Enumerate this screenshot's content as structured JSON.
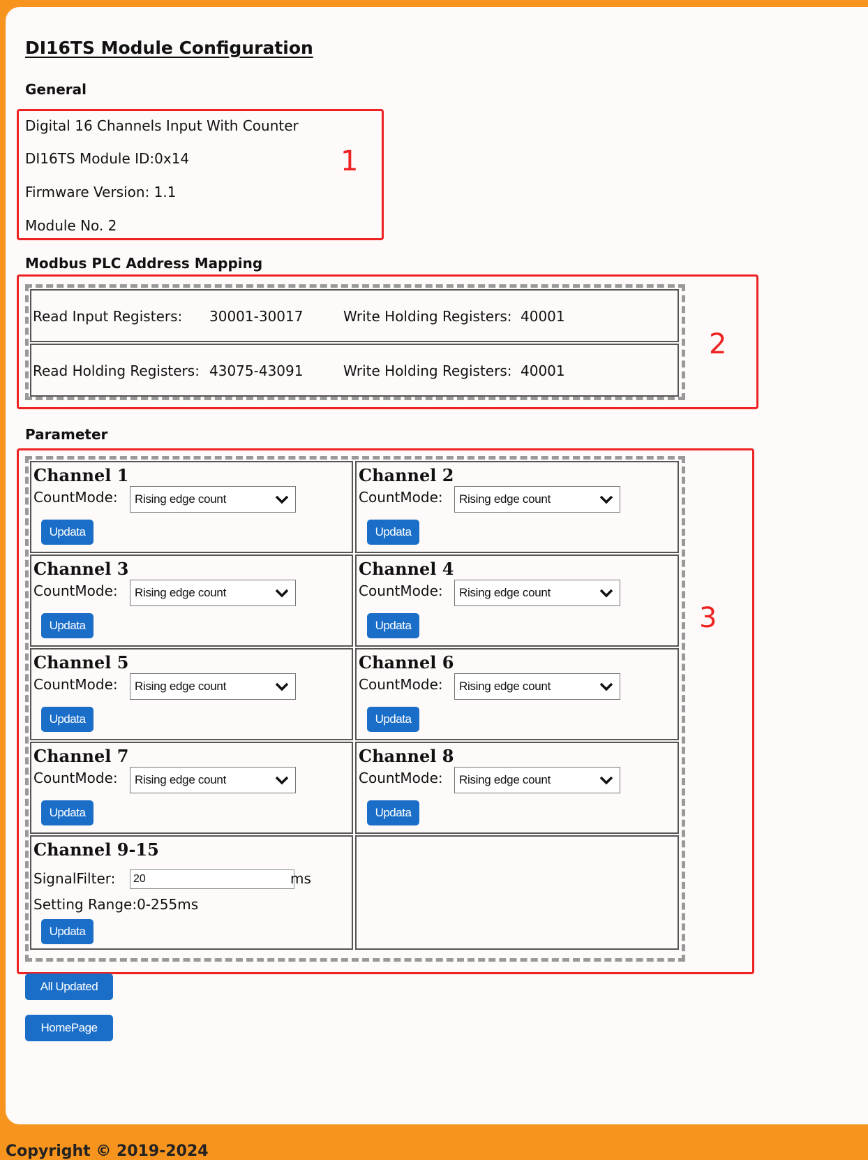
{
  "page": {
    "title": "DI16TS Module Configuration"
  },
  "general": {
    "heading": "General",
    "lines": [
      "Digital 16 Channels Input With Counter",
      "DI16TS Module ID:0x14",
      "Firmware Version: 1.1",
      "Module No. 2"
    ],
    "annotation": "1"
  },
  "modbus": {
    "heading": "Modbus PLC Address Mapping",
    "rows": [
      {
        "label1": "Read Input Registers:",
        "value1": "30001-30017",
        "label2": "Write Holding Registers:",
        "value2": "40001"
      },
      {
        "label1": "Read Holding Registers:",
        "value1": "43075-43091",
        "label2": "Write Holding Registers:",
        "value2": "40001"
      }
    ],
    "annotation": "2"
  },
  "parameter": {
    "heading": "Parameter",
    "annotation": "3",
    "count_mode_label": "CountMode:",
    "update_label": "Updata",
    "channels": [
      {
        "title": "Channel 1",
        "mode": "Rising edge count"
      },
      {
        "title": "Channel 2",
        "mode": "Rising edge count"
      },
      {
        "title": "Channel 3",
        "mode": "Rising edge count"
      },
      {
        "title": "Channel 4",
        "mode": "Rising edge count"
      },
      {
        "title": "Channel 5",
        "mode": "Rising edge count"
      },
      {
        "title": "Channel 6",
        "mode": "Rising edge count"
      },
      {
        "title": "Channel 7",
        "mode": "Rising edge count"
      },
      {
        "title": "Channel 8",
        "mode": "Rising edge count"
      }
    ],
    "filter": {
      "title": "Channel 9-15",
      "label": "SignalFilter:",
      "value": "20",
      "unit": "ms",
      "range": "Setting Range:0-255ms"
    }
  },
  "actions": {
    "all_updated": "All Updated",
    "homepage": "HomePage"
  },
  "footer": {
    "copyright": "Copyright © 2019-2024"
  },
  "colors": {
    "background": "#f7941d",
    "panel": "#fdfaf9",
    "button": "#1a6ec8",
    "annotation": "#ee2222"
  }
}
